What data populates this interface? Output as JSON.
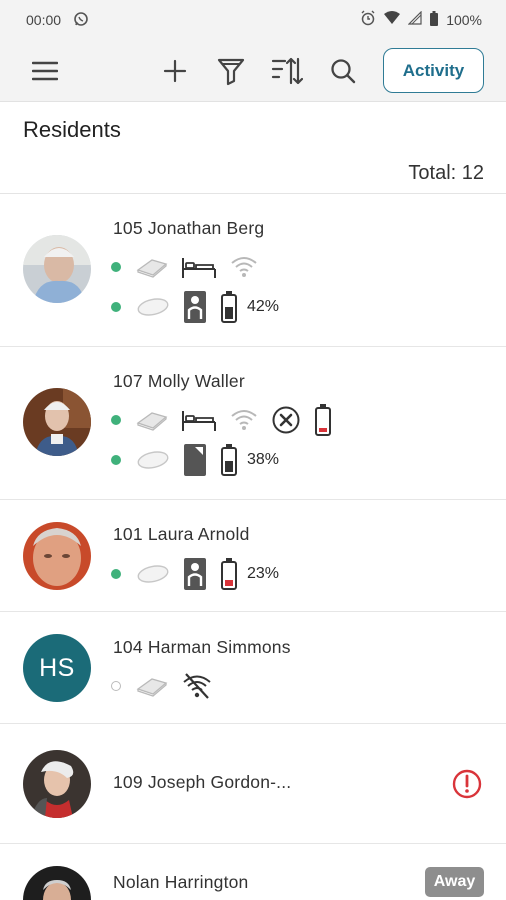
{
  "status_bar": {
    "time": "00:00",
    "battery": "100%"
  },
  "toolbar": {
    "menu_icon": "hamburger-menu-icon",
    "add_icon": "plus-icon",
    "filter_icon": "filter-icon",
    "sort_icon": "sort-icon",
    "search_icon": "search-icon",
    "activity_label": "Activity"
  },
  "header": {
    "title": "Residents",
    "total": "Total: 12"
  },
  "colors": {
    "accent": "#1f6e8c",
    "online": "#3fb17b",
    "alert": "#d9343a",
    "away_badge": "#8e8e8e",
    "initials_bg": "#1b6b78"
  },
  "residents": [
    {
      "name": "105 Jonathan Berg",
      "line1": [
        "online-dot",
        "sensor-pad-icon",
        "bed-icon",
        "wifi-icon"
      ],
      "line2": [
        "online-dot",
        "pendant-icon",
        "person-in-bed-icon",
        "battery-icon"
      ],
      "battery": "42%"
    },
    {
      "name": "107 Molly Waller",
      "line1": [
        "online-dot",
        "sensor-pad-icon",
        "bed-icon",
        "wifi-icon",
        "no-motion-icon",
        "battery-low-icon"
      ],
      "line2": [
        "online-dot",
        "pendant-icon",
        "empty-bed-icon",
        "battery-icon"
      ],
      "battery": "38%"
    },
    {
      "name": "101 Laura Arnold",
      "line1": [
        "online-dot",
        "pendant-icon",
        "person-in-bed-icon",
        "battery-low-icon"
      ],
      "battery": "23%"
    },
    {
      "name": "104 Harman Simmons",
      "initials": "HS",
      "line1": [
        "offline-dot",
        "sensor-pad-icon",
        "wifi-off-icon"
      ]
    },
    {
      "name": "109 Joseph Gordon-...",
      "status_icon": "alert-icon"
    },
    {
      "name": "Nolan Harrington",
      "badge": "Away"
    }
  ]
}
